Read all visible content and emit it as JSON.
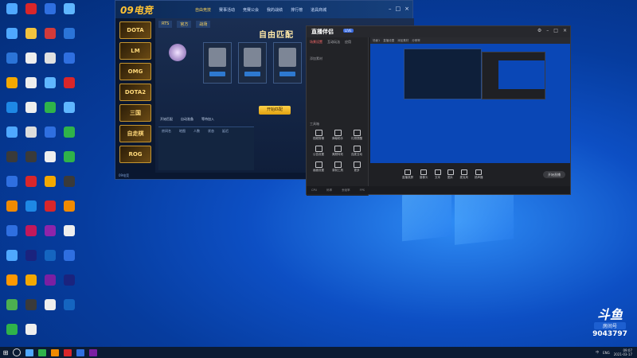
{
  "colors": {
    "desktop": "#0a47b6",
    "accent": "#ffd24a",
    "stream_bg": "#1f2024",
    "game_bg": "#0e1f3a"
  },
  "desktop_icons": [
    {
      "label": "",
      "color": "#4fa8ff"
    },
    {
      "label": "",
      "color": "#d9262a"
    },
    {
      "label": "",
      "color": "#2f6fe0"
    },
    {
      "label": "",
      "color": "#5fb6ff"
    },
    {
      "label": "",
      "color": "#4fa8ff"
    },
    {
      "label": "",
      "color": "#f3c33e"
    },
    {
      "label": "",
      "color": "#d23a3a"
    },
    {
      "label": "",
      "color": "#2b74d8"
    },
    {
      "label": "",
      "color": "#2b74d8"
    },
    {
      "label": "",
      "color": "#eeeeee"
    },
    {
      "label": "",
      "color": "#e0e0e0"
    },
    {
      "label": "",
      "color": "#2f6fe0"
    },
    {
      "label": "",
      "color": "#f4a800"
    },
    {
      "label": "",
      "color": "#eeeeee"
    },
    {
      "label": "",
      "color": "#5fb6ff"
    },
    {
      "label": "",
      "color": "#d9262a"
    },
    {
      "label": "",
      "color": "#1e88e5"
    },
    {
      "label": "",
      "color": "#eeeeee"
    },
    {
      "label": "",
      "color": "#2fb34a"
    },
    {
      "label": "",
      "color": "#5fb6ff"
    },
    {
      "label": "",
      "color": "#4fa8ff"
    },
    {
      "label": "",
      "color": "#dddddd"
    },
    {
      "label": "",
      "color": "#2f6fe0"
    },
    {
      "label": "",
      "color": "#2fb34a"
    },
    {
      "label": "",
      "color": "#3a3a3a"
    },
    {
      "label": "",
      "color": "#3a3a3a"
    },
    {
      "label": "",
      "color": "#eeeeee"
    },
    {
      "label": "",
      "color": "#2fb34a"
    },
    {
      "label": "",
      "color": "#2f6fe0"
    },
    {
      "label": "",
      "color": "#d9262a"
    },
    {
      "label": "",
      "color": "#f4a800"
    },
    {
      "label": "",
      "color": "#3a3a3a"
    },
    {
      "label": "",
      "color": "#f08a00"
    },
    {
      "label": "",
      "color": "#1e88e5"
    },
    {
      "label": "",
      "color": "#d9262a"
    },
    {
      "label": "",
      "color": "#f08a00"
    },
    {
      "label": "",
      "color": "#2f6fe0"
    },
    {
      "label": "",
      "color": "#c2185b"
    },
    {
      "label": "",
      "color": "#8e24aa"
    },
    {
      "label": "",
      "color": "#eeeeee"
    },
    {
      "label": "",
      "color": "#4fa8ff"
    },
    {
      "label": "",
      "color": "#1a237e"
    },
    {
      "label": "",
      "color": "#1565c0"
    },
    {
      "label": "",
      "color": "#2f6fe0"
    },
    {
      "label": "",
      "color": "#ff9800"
    },
    {
      "label": "",
      "color": "#f4a800"
    },
    {
      "label": "",
      "color": "#7b1fa2"
    },
    {
      "label": "",
      "color": "#1a237e"
    },
    {
      "label": "",
      "color": "#4caf50"
    },
    {
      "label": "",
      "color": "#3a3a3a"
    },
    {
      "label": "",
      "color": "#eeeeee"
    },
    {
      "label": "",
      "color": "#1565c0"
    },
    {
      "label": "",
      "color": "#2fb34a"
    },
    {
      "label": "",
      "color": "#eeeeee"
    }
  ],
  "game": {
    "logo": "09电竞",
    "nav": [
      "自由竞技",
      "赛事活动",
      "竞赛公会",
      "我的战绩",
      "排行榜",
      "道具商城"
    ],
    "sidebar": [
      "DOTA",
      "LM",
      "OMG",
      "DOTA2",
      "三国",
      "自走棋",
      "ROG"
    ],
    "tabs": [
      "RTS",
      "官方",
      "战场"
    ],
    "banner": "自由匹配",
    "match_button": "开始匹配",
    "checks": [
      "开始匹配",
      "自动准备",
      "等待加入"
    ],
    "list_header": [
      "房间名",
      "地图",
      "人数",
      "状态",
      "延迟"
    ],
    "ad_text": "赛季",
    "footer": "09电竞"
  },
  "stream": {
    "logo": "直播伴侣",
    "badge": "LIVE",
    "left_tabs": [
      "场景设置",
      "互动玩法",
      "应用"
    ],
    "left_sections": [
      "添加素材",
      "工具箱"
    ],
    "tools": [
      {
        "label": "视频剪辑"
      },
      {
        "label": "弹幕助手"
      },
      {
        "label": "礼物提醒"
      },
      {
        "label": "公告设置"
      },
      {
        "label": "美颜特效"
      },
      {
        "label": "连麦互动"
      },
      {
        "label": "画面设置"
      },
      {
        "label": "录制工具"
      },
      {
        "label": "更多"
      }
    ],
    "preview_bar": [
      "场景1",
      "直播设置",
      "添加素材",
      "分辨率"
    ],
    "toolbar": [
      {
        "label": "直播录屏"
      },
      {
        "label": "摄像头"
      },
      {
        "label": "文本"
      },
      {
        "label": "图片"
      },
      {
        "label": "麦克风"
      },
      {
        "label": "扬声器"
      }
    ],
    "live_button": "开始直播",
    "status": [
      "CPU",
      "码率",
      "丢帧率",
      "FPS"
    ]
  },
  "watermark": {
    "logo": "斗鱼",
    "sub": "房间号",
    "room": "9043797"
  },
  "taskbar": {
    "apps": [
      {
        "color": "#4fa8ff"
      },
      {
        "color": "#2fb34a"
      },
      {
        "color": "#f08a00"
      },
      {
        "color": "#d9262a"
      },
      {
        "color": "#2f6fe0"
      },
      {
        "color": "#7b1fa2"
      }
    ],
    "tray": [
      "中",
      "ENG"
    ],
    "time": "09:07",
    "date": "2021-03-17"
  }
}
